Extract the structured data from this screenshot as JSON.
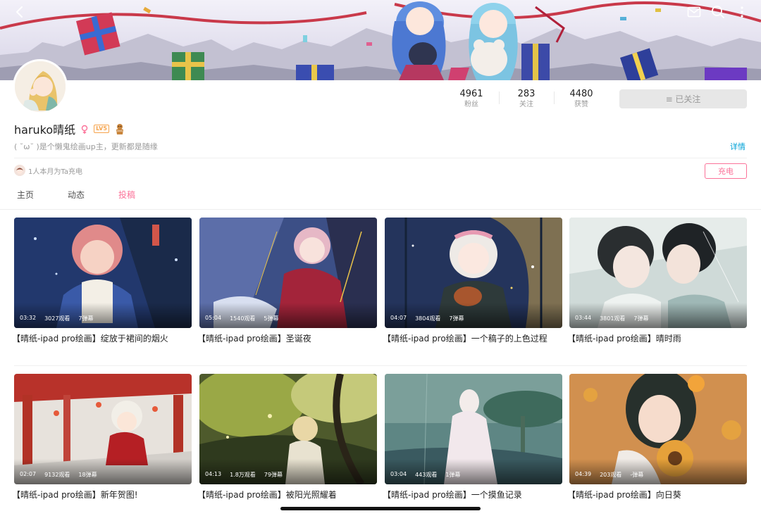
{
  "header": {
    "back_icon": "chevron-left-icon",
    "mail_icon": "mail-icon",
    "search_icon": "search-icon",
    "more_icon": "more-vertical-icon"
  },
  "profile": {
    "username": "haruko晴纸",
    "level": "LV5",
    "bio": "( ˘ω˘ )是个懒鬼绘画up主，更新都是随缘",
    "detail_link": "详情",
    "charge_text": "1人本月为Ta充电",
    "charge_button": "充电",
    "follow_button": "≡ 已关注",
    "stats": [
      {
        "value": "4961",
        "label": "粉丝"
      },
      {
        "value": "283",
        "label": "关注"
      },
      {
        "value": "4480",
        "label": "获赞"
      }
    ]
  },
  "tabs": [
    {
      "label": "主页",
      "active": false
    },
    {
      "label": "动态",
      "active": false
    },
    {
      "label": "投稿",
      "active": true
    }
  ],
  "videos": [
    {
      "duration": "03:32",
      "views": "3027观看",
      "danmaku": "7弹幕",
      "title": "【晴纸-ipad  pro绘画】绽放于裙间的烟火"
    },
    {
      "duration": "05:04",
      "views": "1540观看",
      "danmaku": "5弹幕",
      "title": "【晴纸-ipad  pro绘画】圣诞夜"
    },
    {
      "duration": "04:07",
      "views": "3804观看",
      "danmaku": "7弹幕",
      "title": "【晴纸-ipad  pro绘画】一个稿子的上色过程"
    },
    {
      "duration": "03:44",
      "views": "3801观看",
      "danmaku": "7弹幕",
      "title": "【晴纸-ipad  pro绘画】晴时雨"
    },
    {
      "duration": "02:07",
      "views": "9132观看",
      "danmaku": "18弹幕",
      "title": "【晴纸-ipad  pro绘画】新年贺图!"
    },
    {
      "duration": "04:13",
      "views": "1.8万观看",
      "danmaku": "79弹幕",
      "title": "【晴纸-ipad  pro绘画】被阳光照耀着"
    },
    {
      "duration": "03:04",
      "views": "443观看",
      "danmaku": "1弹幕",
      "title": "【晴纸-ipad  pro绘画】一个摸鱼记录"
    },
    {
      "duration": "04:39",
      "views": "203观看",
      "danmaku": "-弹幕",
      "title": "【晴纸-ipad  pro绘画】向日葵"
    }
  ],
  "colors": {
    "accent_pink": "#fb7299",
    "link_blue": "#00a1d6",
    "muted_text": "#999999"
  }
}
